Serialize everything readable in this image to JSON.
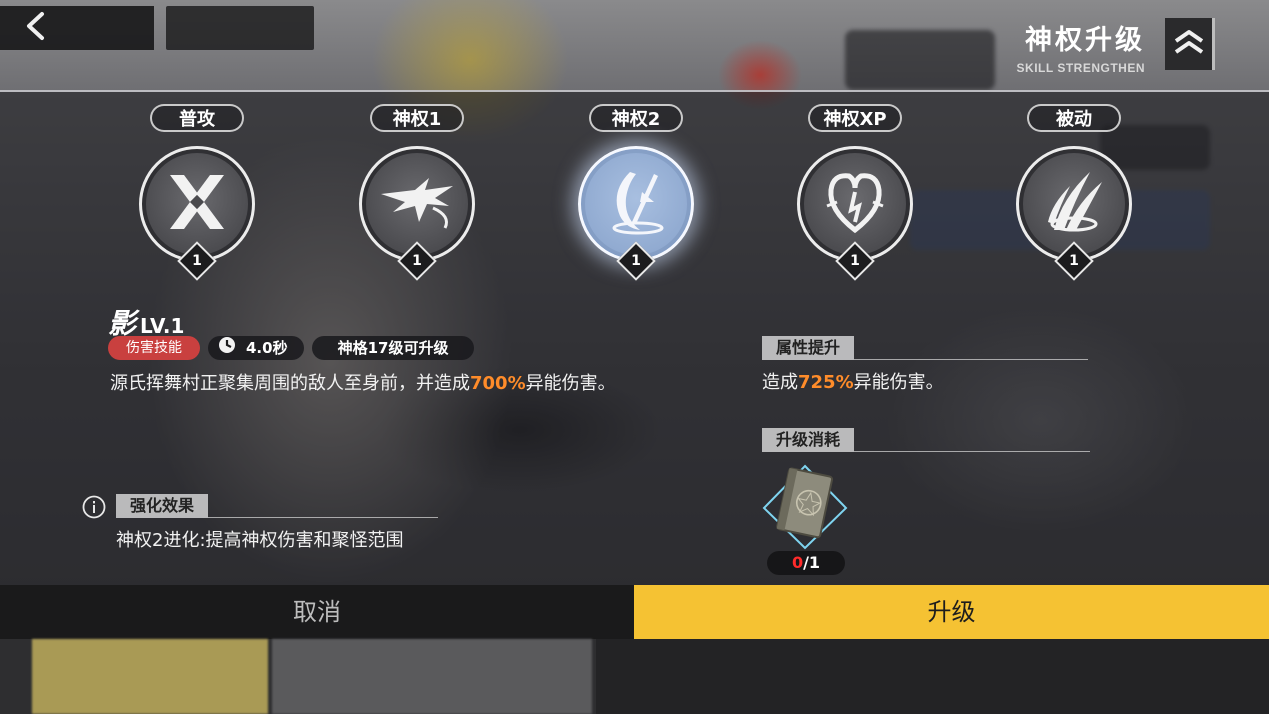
{
  "header": {
    "title": "神权升级",
    "subtitle": "SKILL STRENGTHEN",
    "back_icon": "chevron-left-icon",
    "collapse_icon": "double-chevron-up-icon"
  },
  "skill_tabs": [
    {
      "label": "普攻",
      "level": "1",
      "icon": "cross-swords-icon",
      "selected": false
    },
    {
      "label": "神权1",
      "level": "1",
      "icon": "dragon-strike-icon",
      "selected": false
    },
    {
      "label": "神权2",
      "level": "1",
      "icon": "blade-swirl-icon",
      "selected": true
    },
    {
      "label": "神权XP",
      "level": "1",
      "icon": "flame-heart-icon",
      "selected": false
    },
    {
      "label": "被动",
      "level": "1",
      "icon": "slash-burst-icon",
      "selected": false
    }
  ],
  "skill": {
    "name": "影",
    "level": "LV.1",
    "type_tag": "伤害技能",
    "cooldown": "4.0秒",
    "upgrade_requirement": "神格17级可升级",
    "description_pre": "源氏挥舞村正聚集周围的敌人至身前，并造成",
    "description_value": "700%",
    "description_post": "异能伤害。"
  },
  "enhancement": {
    "heading": "强化效果",
    "text": "神权2进化:提高神权伤害和聚怪范围"
  },
  "attribute": {
    "heading": "属性提升",
    "text_pre": "造成",
    "text_value": "725%",
    "text_post": "异能伤害。"
  },
  "cost": {
    "heading": "升级消耗",
    "item_icon": "skill-book-icon",
    "have": "0",
    "need": "/1"
  },
  "actions": {
    "cancel_label": "取消",
    "upgrade_label": "升级"
  },
  "colors": {
    "highlight": "#ff8c2a",
    "upgrade_button": "#f5c233",
    "damage_tag": "#c9403f",
    "selected_skill": "#8ea8cf"
  }
}
